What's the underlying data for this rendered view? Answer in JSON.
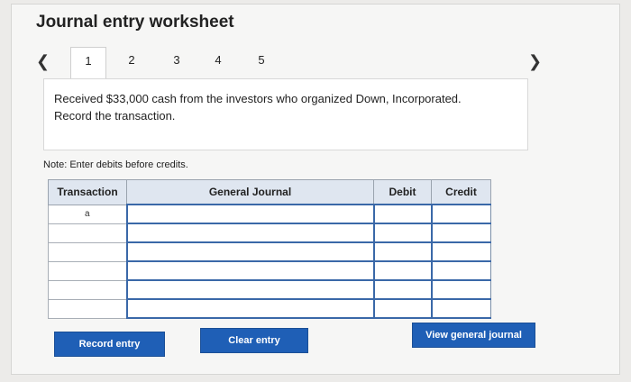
{
  "title": "Journal entry worksheet",
  "tabs": [
    "1",
    "2",
    "3",
    "4",
    "5"
  ],
  "active_tab": "1",
  "question": {
    "line1": "Received $33,000 cash from the investors who organized Down, Incorporated.",
    "line2": "Record the transaction."
  },
  "note": "Note: Enter debits before credits.",
  "table": {
    "headers": {
      "transaction": "Transaction",
      "general_journal": "General Journal",
      "debit": "Debit",
      "credit": "Credit"
    },
    "rows": [
      {
        "transaction": "a",
        "account": "",
        "debit": "",
        "credit": ""
      },
      {
        "transaction": "",
        "account": "",
        "debit": "",
        "credit": ""
      },
      {
        "transaction": "",
        "account": "",
        "debit": "",
        "credit": ""
      },
      {
        "transaction": "",
        "account": "",
        "debit": "",
        "credit": ""
      },
      {
        "transaction": "",
        "account": "",
        "debit": "",
        "credit": ""
      },
      {
        "transaction": "",
        "account": "",
        "debit": "",
        "credit": ""
      }
    ]
  },
  "buttons": {
    "record": "Record entry",
    "clear": "Clear entry",
    "view": "View general journal"
  },
  "colors": {
    "accent": "#1f5fb6",
    "header_bg": "#dfe6f0",
    "input_border": "#3a68a8"
  }
}
